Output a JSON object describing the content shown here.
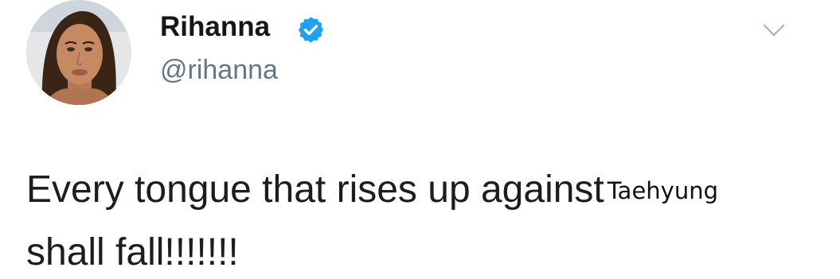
{
  "tweet": {
    "display_name": "Rihanna",
    "handle": "@rihanna",
    "verified": true,
    "text_part1": "Every tongue that rises up against",
    "overlay_name": "Taehyung",
    "text_part2": "shall fall!!!!!!!"
  },
  "icons": {
    "verified": "verified-badge-icon",
    "menu": "chevron-down-icon"
  },
  "colors": {
    "verified_blue": "#1da1f2",
    "handle_gray": "#657786",
    "chevron_gray": "#aab8c2"
  }
}
